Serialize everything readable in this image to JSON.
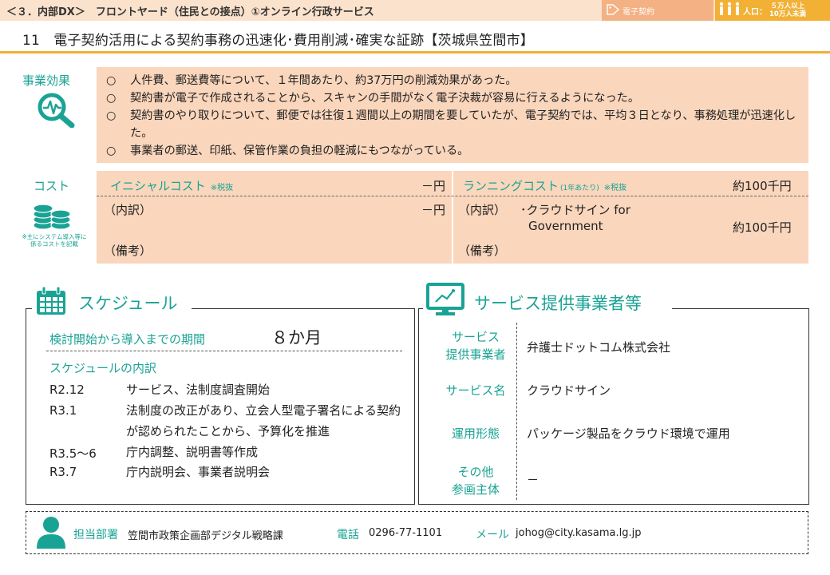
{
  "header": {
    "title": "＜３．内部DX＞　フロントヤード（住民との接点）①オンライン行政サービス",
    "tag_contract": "電子契約",
    "tag_population_label": "人口：",
    "tag_population_range_1": "５万人以上",
    "tag_population_range_2": "10万人未満",
    "colors": {
      "header_bg": "#fbe2cc",
      "tag_contract": "#f4b183",
      "tag_population": "#f2b035",
      "accent": "#1aa394",
      "panel": "#fad6bc"
    }
  },
  "page_title": "11　電子契約活用による契約事務の迅速化･費用削減･確実な証跡【茨城県笠間市】",
  "effects": {
    "label": "事業効果",
    "icon": "magnifier-chart-icon",
    "bullet": "○",
    "items": [
      "人件費、郵送費等について、１年間あたり、約37万円の削減効果があった。",
      "契約書が電子で作成されることから、スキャンの手間がなく電子決裁が容易に行えるようになった。",
      "契約書のやり取りについて、郵便では往復１週間以上の期間を要していたが、電子契約では、平均３日となり、事務処理が迅速化した。",
      "事業者の郵送、印紙、保管作業の負担の軽減にもつながっている。"
    ]
  },
  "cost": {
    "label": "コスト",
    "icon": "coins-icon",
    "note": "※主にシステム導入等に係るコストを記載",
    "initial": {
      "heading": "イニシャルコスト",
      "tax_note": "※税抜",
      "amount": "－円",
      "breakdown_label": "（内訳）",
      "breakdown_amount": "－円",
      "remarks_label": "（備考）"
    },
    "running": {
      "heading": "ランニングコスト",
      "period_note": "(1年あたり)",
      "tax_note": "※税抜",
      "amount": "約100千円",
      "breakdown_label": "（内訳）",
      "item_line1": "･クラウドサイン for",
      "item_line2": "Government",
      "item_amount": "約100千円",
      "remarks_label": "（備考）"
    }
  },
  "schedule": {
    "title": "スケジュール",
    "icon": "calendar-icon",
    "period_label": "検討開始から導入までの期間",
    "period_value": "８か月",
    "breakdown_label": "スケジュールの内訳",
    "rows": [
      {
        "date": "R2.12",
        "text": "サービス、法制度調査開始"
      },
      {
        "date": "R3.1",
        "text": "法制度の改正があり、立会人型電子署名による契約が認められたことから、予算化を推進"
      },
      {
        "date": "R3.5～6",
        "text": "庁内調整、説明書等作成"
      },
      {
        "date": "R3.7",
        "text": "庁内説明会、事業者説明会"
      }
    ]
  },
  "provider": {
    "title": "サービス提供事業者等",
    "icon": "monitor-icon",
    "rows": [
      {
        "label_1": "サービス",
        "label_2": "提供事業者",
        "value": "弁護士ドットコム株式会社"
      },
      {
        "label_1": "サービス名",
        "label_2": "",
        "value": "クラウドサイン"
      },
      {
        "label_1": "運用形態",
        "label_2": "",
        "value": "パッケージ製品をクラウド環境で運用"
      },
      {
        "label_1": "その他",
        "label_2": "参画主体",
        "value": "－"
      }
    ]
  },
  "contact": {
    "icon": "person-icon",
    "dept_label": "担当部署",
    "dept_value": "笠間市政策企画部デジタル戦略課",
    "phone_label": "電話",
    "phone_value": "0296-77-1101",
    "mail_label": "メール",
    "mail_value": "johog@city.kasama.lg.jp"
  }
}
